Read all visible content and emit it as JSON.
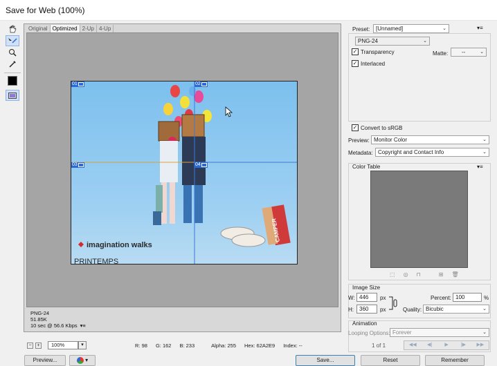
{
  "window": {
    "title": "Save for Web (100%)"
  },
  "toolbox": {
    "tools": [
      {
        "name": "hand-tool",
        "glyph": "✋"
      },
      {
        "name": "slice-select-tool",
        "glyph": "↘"
      },
      {
        "name": "zoom-tool",
        "glyph": "🔍"
      },
      {
        "name": "eyedropper-tool",
        "glyph": "✒"
      }
    ],
    "eyedropper_color": "#000000"
  },
  "view_tabs": [
    "Original",
    "Optimized",
    "2-Up",
    "4-Up"
  ],
  "active_tab": "Optimized",
  "image": {
    "slices": [
      {
        "id": "01"
      },
      {
        "id": "02"
      },
      {
        "id": "03"
      },
      {
        "id": "04"
      }
    ],
    "texts": {
      "brand": "imagination walks",
      "store": "PRINTEMPS",
      "bag": "CAMPER"
    },
    "colors": {
      "sky": "#8fc7ee",
      "floor": "#a9d4f2"
    }
  },
  "info": {
    "format": "PNG-24",
    "size": "51.85K",
    "time": "10 sec @ 56.6 Kbps"
  },
  "status": {
    "zoom": "100%",
    "r": "R: 98",
    "g": "G: 162",
    "b": "B: 233",
    "alpha": "Alpha: 255",
    "hex": "Hex: 62A2E9",
    "index": "Index: --"
  },
  "buttons": {
    "preview": "Preview...",
    "save": "Save...",
    "reset": "Reset",
    "remember": "Remember"
  },
  "settings": {
    "preset_label": "Preset:",
    "preset_value": "[Unnamed]",
    "format_value": "PNG-24",
    "transparency_label": "Transparency",
    "transparency_checked": true,
    "matte_label": "Matte:",
    "matte_value": "--",
    "interlaced_label": "Interlaced",
    "interlaced_checked": true,
    "convert_label": "Convert to sRGB",
    "convert_checked": true,
    "preview_label": "Preview:",
    "preview_value": "Monitor Color",
    "metadata_label": "Metadata:",
    "metadata_value": "Copyright and Contact Info"
  },
  "color_table": {
    "title": "Color Table",
    "fill": "#7a7a7a"
  },
  "image_size": {
    "title": "Image Size",
    "w_label": "W:",
    "w_value": "446",
    "h_label": "H:",
    "h_value": "360",
    "unit": "px",
    "percent_label": "Percent:",
    "percent_value": "100",
    "percent_unit": "%",
    "quality_label": "Quality:",
    "quality_value": "Bicubic"
  },
  "animation": {
    "title": "Animation",
    "looping_label": "Looping Options:",
    "looping_value": "Forever",
    "frame": "1 of 1"
  }
}
